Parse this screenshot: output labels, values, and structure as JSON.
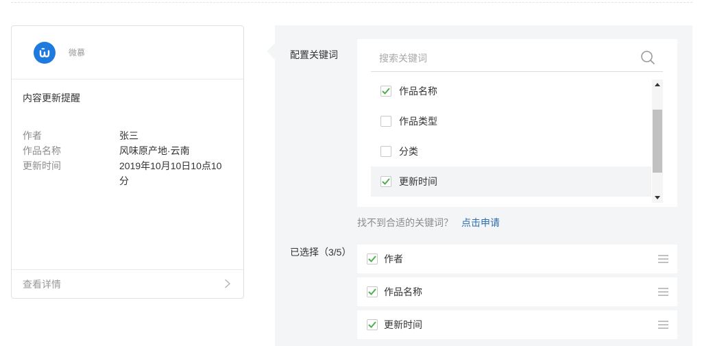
{
  "colors": {
    "brand_blue": "#1f7ae0",
    "link_blue": "#2b6cb3",
    "check_green": "#4cae4c",
    "panel_background": "#f4f5f6"
  },
  "preview_card": {
    "logo_icon": "brand-logo-icon",
    "brand_name": "微慕",
    "title": "内容更新提醒",
    "fields": [
      {
        "label": "作者",
        "value": "张三"
      },
      {
        "label": "作品名称",
        "value": "风味原产地·云南"
      },
      {
        "label": "更新时间",
        "value": "2019年10月10日10点10分"
      }
    ],
    "footer_link": "查看详情",
    "footer_icon": "chevron-right-icon"
  },
  "keyword_config": {
    "label": "配置关键词",
    "search": {
      "placeholder": "搜索关键词",
      "value": "",
      "icon": "search-icon"
    },
    "options": [
      {
        "label": "作品名称",
        "checked": true,
        "highlighted": false
      },
      {
        "label": "作品类型",
        "checked": false,
        "highlighted": false
      },
      {
        "label": "分类",
        "checked": false,
        "highlighted": false
      },
      {
        "label": "更新时间",
        "checked": true,
        "highlighted": true
      }
    ],
    "hint_text": "找不到合适的关键词？",
    "apply_link": "点击申请"
  },
  "selected": {
    "label": "已选择（3/5）",
    "items": [
      {
        "label": "作者",
        "checked": true,
        "handle_icon": "drag-handle-icon"
      },
      {
        "label": "作品名称",
        "checked": true,
        "handle_icon": "drag-handle-icon"
      },
      {
        "label": "更新时间",
        "checked": true,
        "handle_icon": "drag-handle-icon"
      }
    ]
  }
}
